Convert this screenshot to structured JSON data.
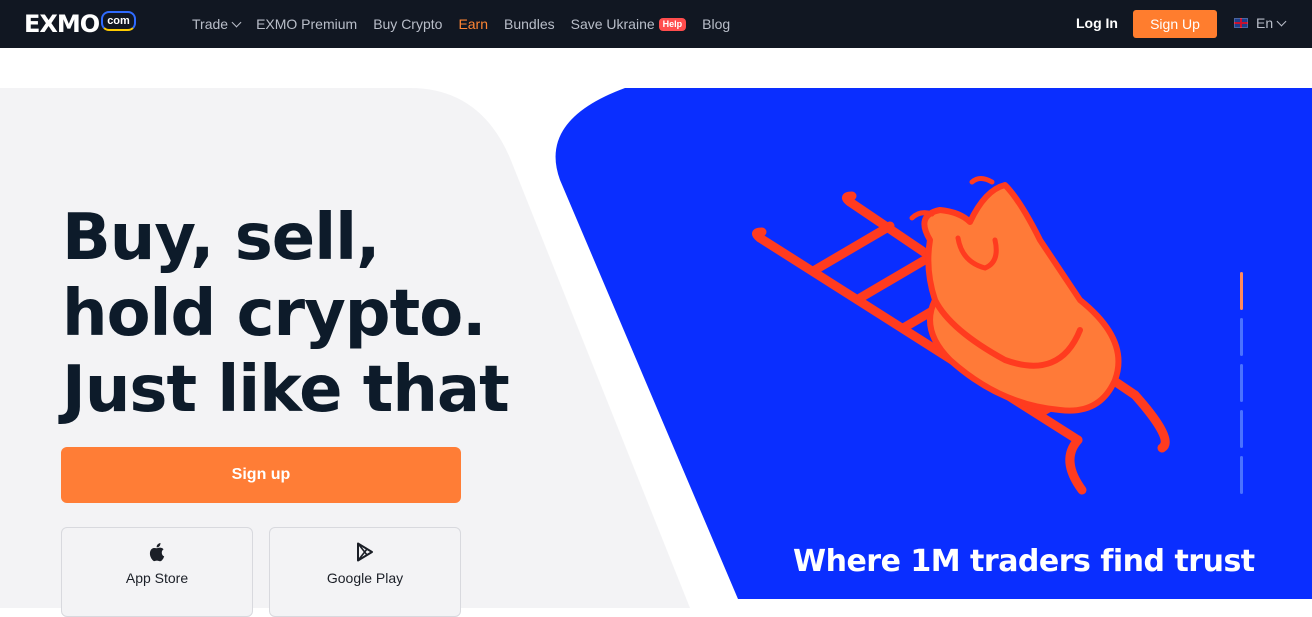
{
  "logo": {
    "word": "EXMO",
    "badge": "com"
  },
  "nav": {
    "items": [
      {
        "label": "Trade",
        "has_dropdown": true
      },
      {
        "label": "EXMO Premium"
      },
      {
        "label": "Buy Crypto"
      },
      {
        "label": "Earn",
        "highlight_color": "#ff8533"
      },
      {
        "label": "Bundles"
      },
      {
        "label": "Save Ukraine",
        "badge": "Help"
      },
      {
        "label": "Blog"
      }
    ],
    "login_label": "Log In",
    "signup_label": "Sign Up",
    "language": "En"
  },
  "hero": {
    "headline": [
      "Buy, sell,",
      "hold crypto.",
      "Just like that"
    ],
    "cta_label": "Sign up",
    "stores": [
      {
        "label": "App Store",
        "icon": "apple-icon"
      },
      {
        "label": "Google Play",
        "icon": "google-play-icon"
      }
    ]
  },
  "banner": {
    "tagline": "Where 1M traders find trust",
    "slide_count": 5,
    "active_slide": 1,
    "colors": {
      "background": "#0a2eff",
      "accent": "#ff5a1f",
      "fill": "#ff7a38"
    }
  },
  "colors": {
    "topbar": "#111722",
    "brand_orange": "#ff7d36",
    "hero_bg": "#f3f3f5",
    "headline": "#0d1b2a"
  }
}
